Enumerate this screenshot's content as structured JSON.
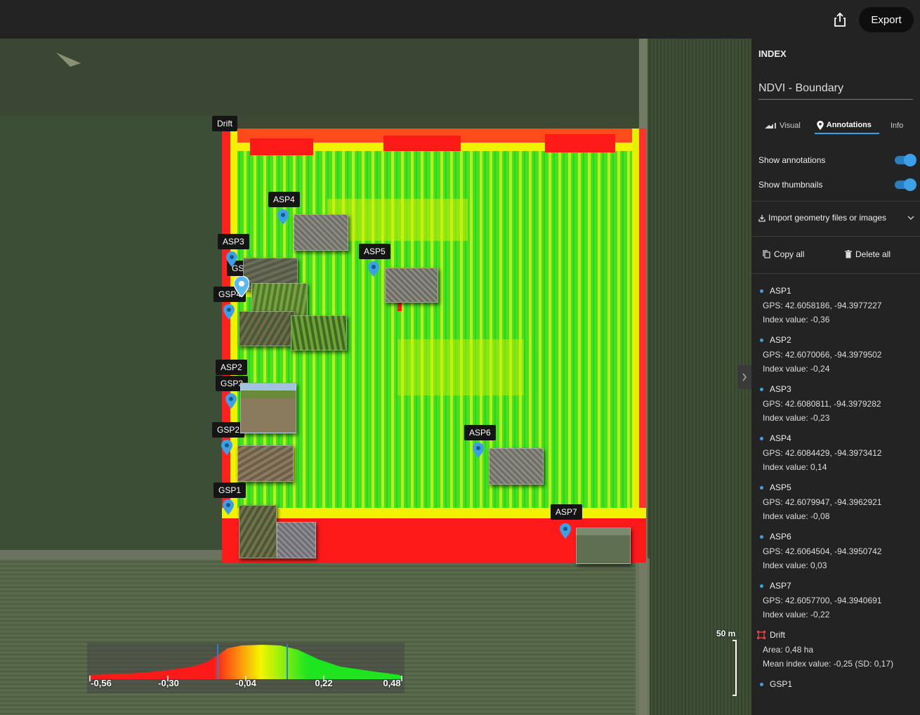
{
  "toolbar": {
    "share_icon": "share-icon",
    "export_label": "Export"
  },
  "map": {
    "labels": {
      "drift": "Drift",
      "asp4": "ASP4",
      "asp3": "ASP3",
      "gsp5": "GSP5",
      "asp5": "ASP5",
      "gsp4": "GSP4",
      "asp2": "ASP2",
      "gsp3": "GSP3",
      "gsp2": "GSP2",
      "gsp1": "GSP1",
      "asp6": "ASP6",
      "asp7": "ASP7"
    },
    "legend": {
      "ticks": [
        "-0,56",
        "-0,30",
        "-0,04",
        "0,22",
        "0,48"
      ]
    },
    "scale_label": "50 m"
  },
  "panel": {
    "title": "INDEX",
    "layer_name": "NDVI - Boundary",
    "tabs": [
      {
        "label": "Visual",
        "icon": "chart-icon"
      },
      {
        "label": "Annotations",
        "icon": "pin-icon",
        "active": true
      },
      {
        "label": "Info"
      }
    ],
    "toggles": [
      {
        "label": "Show annotations",
        "on": true
      },
      {
        "label": "Show thumbnails",
        "on": true
      }
    ],
    "import_label": "Import geometry files or images",
    "copy_all": "Copy all",
    "delete_all": "Delete all",
    "annotations": [
      {
        "name": "ASP1",
        "gps": "GPS: 42.6058186, -94.3977227",
        "value": "Index value: -0,36"
      },
      {
        "name": "ASP2",
        "gps": "GPS: 42.6070066, -94.3979502",
        "value": "Index value: -0,24"
      },
      {
        "name": "ASP3",
        "gps": "GPS: 42.6080811, -94.3979282",
        "value": "Index value: -0,23"
      },
      {
        "name": "ASP4",
        "gps": "GPS: 42.6084429, -94.3973412",
        "value": "Index value: 0,14"
      },
      {
        "name": "ASP5",
        "gps": "GPS: 42.6079947, -94.3962921",
        "value": "Index value: -0,08"
      },
      {
        "name": "ASP6",
        "gps": "GPS: 42.6064504, -94.3950742",
        "value": "Index value: 0,03"
      },
      {
        "name": "ASP7",
        "gps": "GPS: 42.6057700, -94.3940691",
        "value": "Index value: -0,22"
      }
    ],
    "drift": {
      "name": "Drift",
      "area": "Area: 0,48 ha",
      "mean": "Mean index value: -0,25 (SD: 0,17)"
    },
    "gsp1": {
      "name": "GSP1"
    }
  },
  "colors": {
    "accent": "#3da0e6",
    "ndvi_low": "#ff1a1a",
    "ndvi_mid": "#f5f500",
    "ndvi_high": "#1ee61e"
  }
}
